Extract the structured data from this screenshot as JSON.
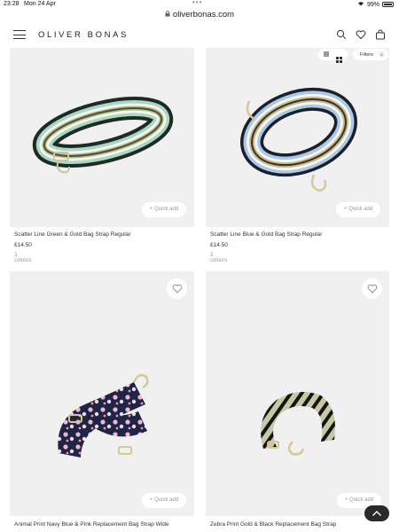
{
  "status": {
    "time": "23:28",
    "date": "Mon 24 Apr",
    "battery": "99%"
  },
  "browser": {
    "url": "oliverbonas.com"
  },
  "header": {
    "brand": "OLIVER BONAS",
    "icons": [
      "menu-icon",
      "search-icon",
      "heart-icon",
      "bag-icon"
    ]
  },
  "controls": {
    "filters_label": "Filters",
    "filters_count": "1"
  },
  "products": [
    {
      "name": "Scatter Line Green & Gold Bag Strap Regular",
      "price": "£14.50",
      "colours": "3 colours",
      "quick_add": "+ Quick add"
    },
    {
      "name": "Scatter Line Blue & Gold Bag Strap Regular",
      "price": "£14.50",
      "colours": "3 colours",
      "quick_add": "+ Quick add"
    },
    {
      "name": "Animal Print Navy Blue & Pink Replacement Bag Strap Wide",
      "quick_add": "+ Quick add"
    },
    {
      "name": "Zebra Print Gold & Black Replacement Bag Strap",
      "quick_add": "+ Quick add"
    }
  ],
  "colors": {
    "image_bg": "#f0f0f0",
    "scroll_top_bg": "#2a2a2a"
  }
}
